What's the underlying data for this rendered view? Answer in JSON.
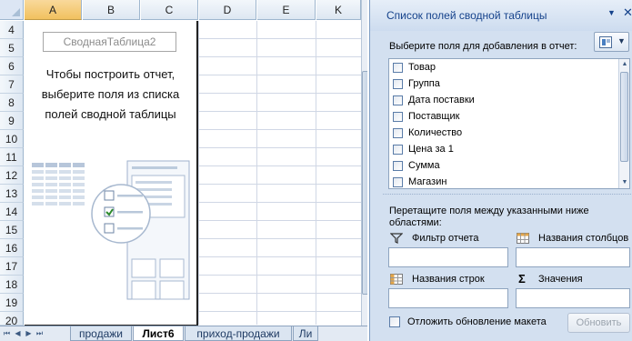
{
  "sheet": {
    "columns": [
      "A",
      "B",
      "C",
      "D",
      "E",
      "K"
    ],
    "selected_column": "A",
    "rows": [
      "4",
      "5",
      "6",
      "7",
      "8",
      "9",
      "10",
      "11",
      "12",
      "13",
      "14",
      "15",
      "16",
      "17",
      "18",
      "19",
      "20"
    ],
    "pivot_placeholder": {
      "name": "СводнаяТаблица2",
      "instruction_lines": [
        "Чтобы построить отчет,",
        "выберите поля из списка",
        "полей сводной таблицы"
      ]
    },
    "tabs": [
      "продажи",
      "Лист6",
      "приход-продажи",
      "Ли"
    ],
    "active_tab": "Лист6"
  },
  "pane": {
    "title": "Список полей сводной таблицы",
    "choose_label": "Выберите поля для добавления в отчет:",
    "fields": [
      {
        "label": "Товар",
        "checked": false
      },
      {
        "label": "Группа",
        "checked": false
      },
      {
        "label": "Дата поставки",
        "checked": false
      },
      {
        "label": "Поставщик",
        "checked": false
      },
      {
        "label": "Количество",
        "checked": false
      },
      {
        "label": "Цена за 1",
        "checked": false
      },
      {
        "label": "Сумма",
        "checked": false
      },
      {
        "label": "Магазин",
        "checked": false
      }
    ],
    "drag_label": "Перетащите поля между указанными ниже областями:",
    "areas": {
      "report_filter": "Фильтр отчета",
      "column_labels": "Названия столбцов",
      "row_labels": "Названия строк",
      "values": "Значения"
    },
    "defer_label": "Отложить обновление макета",
    "update_button": "Обновить"
  },
  "icons": {
    "filter": "funnel-icon",
    "columns": "column-grid-icon",
    "rows": "row-grid-icon",
    "values": "sigma-icon",
    "layout": "field-list-layout-icon"
  },
  "colors": {
    "pane_background": "#d3e0f0",
    "pane_title": "#15428b",
    "selected_column": "#f1c15f",
    "active_tab": "#ffffff"
  }
}
